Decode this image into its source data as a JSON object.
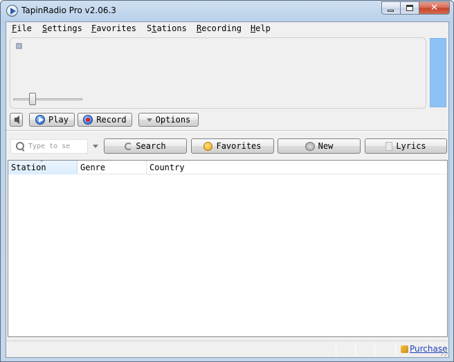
{
  "window": {
    "title": "TapinRadio Pro v2.06.3",
    "close_glyph": "✕"
  },
  "menu": [
    {
      "mnemonic": "F",
      "rest": "ile"
    },
    {
      "mnemonic": "S",
      "rest": "ettings"
    },
    {
      "mnemonic": "F",
      "rest": "avorites",
      "prefix": "",
      "full": "Favorites"
    },
    {
      "prefix": "S",
      "mnemonic": "t",
      "rest": "ations"
    },
    {
      "mnemonic": "R",
      "rest": "ecording"
    },
    {
      "mnemonic": "H",
      "rest": "elp"
    }
  ],
  "player": {
    "play_label": "Play",
    "record_label": "Record",
    "options_label": "Options",
    "volume_level": 0.28
  },
  "toolbar": {
    "search_placeholder": "Type to se",
    "search_label": "Search",
    "favorites_label": "Favorites",
    "new_label": "New",
    "lyrics_label": "Lyrics"
  },
  "list": {
    "columns": [
      "Station",
      "Genre",
      "Country"
    ],
    "sort_glyph": "^",
    "rows": []
  },
  "status": {
    "purchase_label": "Purchase"
  },
  "colors": {
    "level_meter": "#8ec2f7",
    "link": "#1a3fb8"
  }
}
